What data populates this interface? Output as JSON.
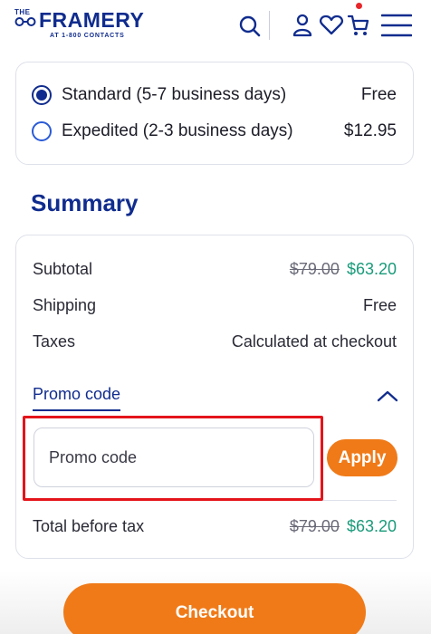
{
  "header": {
    "logo": {
      "the": "THE",
      "wordmark": "FRAMERY",
      "subline": "AT 1-800 CONTACTS"
    },
    "icons": [
      "search-icon",
      "account-icon",
      "heart-icon",
      "cart-icon",
      "menu-icon"
    ],
    "cart_badge_color": "#e8262b"
  },
  "shipping": {
    "options": [
      {
        "label": "Standard (5-7 business days)",
        "price": "Free",
        "selected": true
      },
      {
        "label": "Expedited (2-3 business days)",
        "price": "$12.95",
        "selected": false
      }
    ]
  },
  "summary": {
    "title": "Summary",
    "subtotal": {
      "label": "Subtotal",
      "original": "$79.00",
      "sale": "$63.20"
    },
    "shipping": {
      "label": "Shipping",
      "value": "Free"
    },
    "taxes": {
      "label": "Taxes",
      "value": "Calculated at checkout"
    },
    "promo": {
      "toggle_label": "Promo code",
      "input_placeholder": "Promo code",
      "apply_label": "Apply"
    },
    "total": {
      "label": "Total before tax",
      "original": "$79.00",
      "sale": "$63.20"
    }
  },
  "checkout": {
    "label": "Checkout"
  },
  "colors": {
    "brand_navy": "#102c8e",
    "accent_orange": "#f07a18",
    "sale_green": "#1a9b7a",
    "highlight_red": "#e4141b"
  }
}
